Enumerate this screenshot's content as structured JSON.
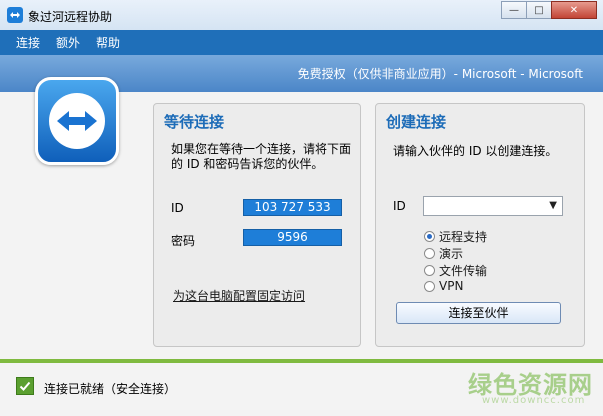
{
  "window": {
    "title": "象过河远程协助"
  },
  "menu": [
    "连接",
    "额外",
    "帮助"
  ],
  "header": {
    "license": "免费授权（仅供非商业应用）- Microsoft - Microsoft"
  },
  "wait_panel": {
    "title": "等待连接",
    "description": "如果您在等待一个连接，请将下面的 ID 和密码告诉您的伙伴。",
    "id_label": "ID",
    "id_value": "103 727 533",
    "password_label": "密码",
    "password_value": "9596",
    "fixed_access_link": "为这台电脑配置固定访问"
  },
  "create_panel": {
    "title": "创建连接",
    "description": "请输入伙伴的 ID 以创建连接。",
    "id_label": "ID",
    "id_input_value": "",
    "options": [
      {
        "label": "远程支持",
        "selected": true
      },
      {
        "label": "演示",
        "selected": false
      },
      {
        "label": "文件传输",
        "selected": false
      },
      {
        "label": "VPN",
        "selected": false
      }
    ],
    "connect_button": "连接至伙伴"
  },
  "status": {
    "text": "连接已就绪（安全连接）"
  },
  "watermark": {
    "main": "绿色资源网",
    "sub": "www.downcc.com"
  },
  "colors": {
    "accent": "#1e7ed8",
    "menubar": "#1f6fb9",
    "status_green": "#5a9f2f"
  }
}
